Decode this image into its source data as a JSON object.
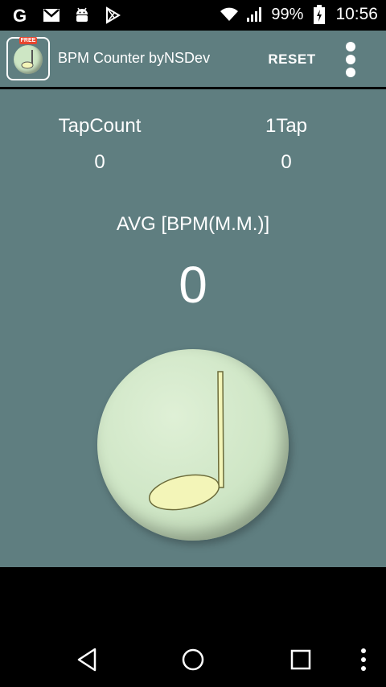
{
  "status_bar": {
    "battery": "99%",
    "time": "10:56",
    "icons": [
      "google-icon",
      "gmail-icon",
      "android-icon",
      "play-store-icon",
      "wifi-icon",
      "signal-icon",
      "battery-icon"
    ]
  },
  "action_bar": {
    "app_icon_badge": "FREE",
    "title": "BPM Counter byNSDev",
    "reset_label": "RESET",
    "overflow_icon": "more-vert-icon"
  },
  "stats": {
    "tap_count_label": "TapCount",
    "tap_count_value": "0",
    "one_tap_label": "1Tap",
    "one_tap_value": "0"
  },
  "avg": {
    "label": "AVG [BPM(M.M.)]",
    "value": "0"
  },
  "tap_button": {
    "icon": "music-note-icon"
  },
  "nav_bar": {
    "icons": [
      "back-icon",
      "home-icon",
      "recents-icon",
      "menu-icon"
    ]
  },
  "colors": {
    "background": "#5f7e80",
    "button": "#cfe6c6",
    "note": "#f3f5b8"
  }
}
